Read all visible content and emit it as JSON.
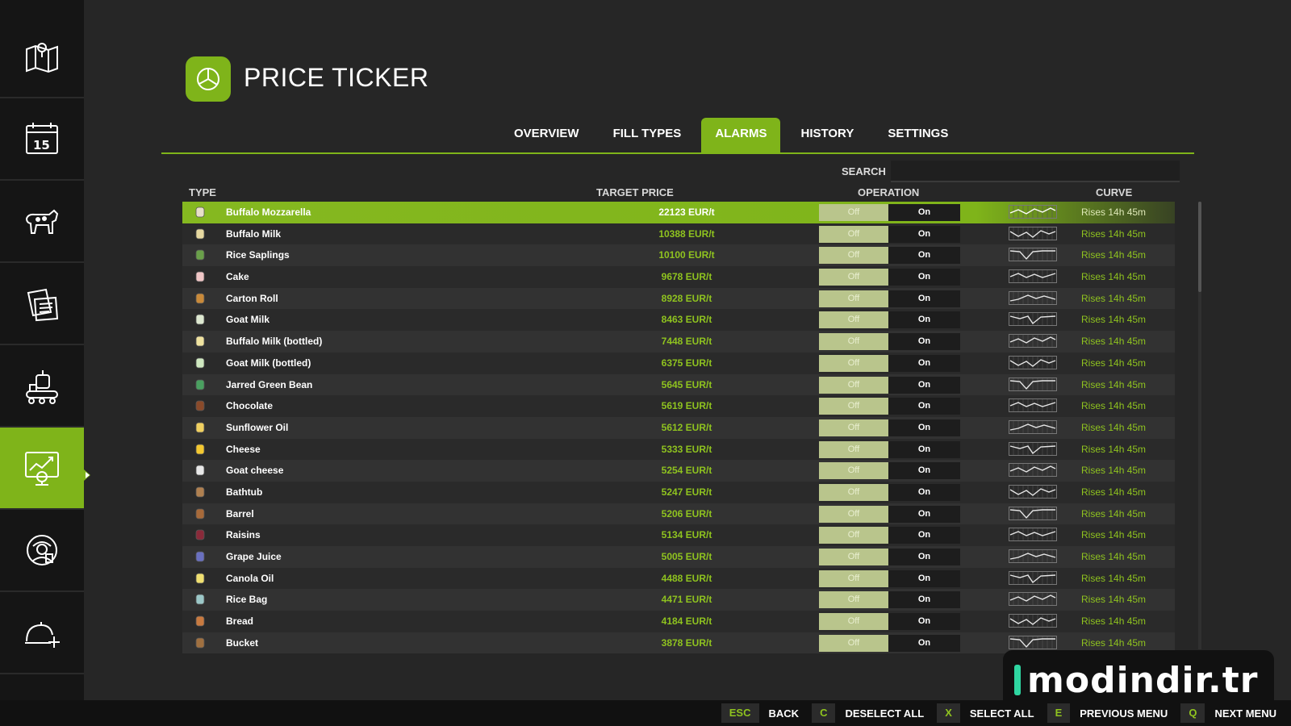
{
  "header": {
    "title": "PRICE TICKER"
  },
  "tabs": [
    {
      "label": "OVERVIEW"
    },
    {
      "label": "FILL TYPES"
    },
    {
      "label": "ALARMS",
      "active": true
    },
    {
      "label": "HISTORY"
    },
    {
      "label": "SETTINGS"
    }
  ],
  "search": {
    "label": "SEARCH",
    "value": ""
  },
  "columns": {
    "type": "TYPE",
    "target_price": "TARGET PRICE",
    "operation": "OPERATION",
    "curve": "CURVE"
  },
  "sidebar": {
    "items": [
      {
        "icon": "map-icon"
      },
      {
        "icon": "calendar-icon"
      },
      {
        "icon": "cow-icon"
      },
      {
        "icon": "documents-icon"
      },
      {
        "icon": "production-icon"
      },
      {
        "icon": "price-chart-icon",
        "active": true
      },
      {
        "icon": "farmer-icon"
      },
      {
        "icon": "contracts-icon"
      }
    ]
  },
  "toggle": {
    "off_label": "Off",
    "on_label": "On"
  },
  "rows": [
    {
      "name": "Buffalo Mozzarella",
      "price": "22123 EUR/t",
      "status": "Rises 14h 45m",
      "selected": true
    },
    {
      "name": "Buffalo Milk",
      "price": "10388 EUR/t",
      "status": "Rises 14h 45m"
    },
    {
      "name": "Rice Saplings",
      "price": "10100 EUR/t",
      "status": "Rises 14h 45m"
    },
    {
      "name": "Cake",
      "price": "9678 EUR/t",
      "status": "Rises 14h 45m"
    },
    {
      "name": "Carton Roll",
      "price": "8928 EUR/t",
      "status": "Rises 14h 45m"
    },
    {
      "name": "Goat Milk",
      "price": "8463 EUR/t",
      "status": "Rises 14h 45m"
    },
    {
      "name": "Buffalo Milk (bottled)",
      "price": "7448 EUR/t",
      "status": "Rises 14h 45m"
    },
    {
      "name": "Goat Milk (bottled)",
      "price": "6375 EUR/t",
      "status": "Rises 14h 45m"
    },
    {
      "name": "Jarred Green Bean",
      "price": "5645 EUR/t",
      "status": "Rises 14h 45m"
    },
    {
      "name": "Chocolate",
      "price": "5619 EUR/t",
      "status": "Rises 14h 45m"
    },
    {
      "name": "Sunflower Oil",
      "price": "5612 EUR/t",
      "status": "Rises 14h 45m"
    },
    {
      "name": "Cheese",
      "price": "5333 EUR/t",
      "status": "Rises 14h 45m"
    },
    {
      "name": "Goat cheese",
      "price": "5254 EUR/t",
      "status": "Rises 14h 45m"
    },
    {
      "name": "Bathtub",
      "price": "5247 EUR/t",
      "status": "Rises 14h 45m"
    },
    {
      "name": "Barrel",
      "price": "5206 EUR/t",
      "status": "Rises 14h 45m"
    },
    {
      "name": "Raisins",
      "price": "5134 EUR/t",
      "status": "Rises 14h 45m"
    },
    {
      "name": "Grape Juice",
      "price": "5005 EUR/t",
      "status": "Rises 14h 45m"
    },
    {
      "name": "Canola Oil",
      "price": "4488 EUR/t",
      "status": "Rises 14h 45m"
    },
    {
      "name": "Rice Bag",
      "price": "4471 EUR/t",
      "status": "Rises 14h 45m"
    },
    {
      "name": "Bread",
      "price": "4184 EUR/t",
      "status": "Rises 14h 45m"
    },
    {
      "name": "Bucket",
      "price": "3878 EUR/t",
      "status": "Rises 14h 45m"
    }
  ],
  "watermark": {
    "text": "modindir.tr"
  },
  "bottom_bar": {
    "actions": [
      {
        "key": "ESC",
        "label": "BACK"
      },
      {
        "key": "C",
        "label": "DESELECT ALL"
      },
      {
        "key": "X",
        "label": "SELECT ALL"
      },
      {
        "key": "E",
        "label": "PREVIOUS MENU"
      },
      {
        "key": "Q",
        "label": "NEXT MENU"
      }
    ]
  },
  "colors": {
    "accent": "#7fb41a",
    "price_text": "#8fc31f",
    "background": "#262626",
    "sidebar": "#151515"
  }
}
